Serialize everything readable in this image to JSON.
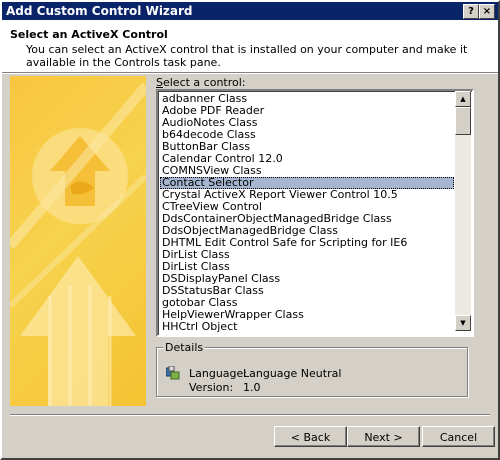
{
  "window": {
    "title": "Add Custom Control Wizard",
    "help_glyph": "?",
    "close_glyph": "×"
  },
  "header": {
    "title": "Select an ActiveX Control",
    "description": "You can select an ActiveX control that is installed on your computer and make it available in the Controls task pane."
  },
  "list": {
    "label": "Select a control:",
    "label_accelerator": "S",
    "label_rest": "elect a control:",
    "selected_index": 7,
    "items": [
      "adbanner Class",
      "Adobe PDF Reader",
      "AudioNotes Class",
      "b64decode Class",
      "ButtonBar Class",
      "Calendar Control 12.0",
      "COMNSView Class",
      "Contact Selector",
      "Crystal ActiveX Report Viewer Control 10.5",
      "CTreeView Control",
      "DdsContainerObjectManagedBridge Class",
      "DdsObjectManagedBridge Class",
      "DHTML Edit Control Safe for Scripting for IE6",
      "DirList Class",
      "DirList Class",
      "DSDisplayPanel Class",
      "DSStatusBar Class",
      "gotobar Class",
      "HelpViewerWrapper Class",
      "HHCtrl Object"
    ],
    "scroll_up_glyph": "▲",
    "scroll_down_glyph": "▼"
  },
  "details": {
    "legend": "Details",
    "language_label": "Language:",
    "language_value": "Language Neutral",
    "version_label": "Version:",
    "version_value": "1.0",
    "icon": "activex-control-icon"
  },
  "buttons": {
    "back": "< Back",
    "next": "Next >",
    "cancel": "Cancel"
  },
  "colors": {
    "titlebar": "#0a246a",
    "dialog": "#d4d0c8",
    "selection": "#a6b6d0",
    "banner": "#f7c93f"
  }
}
